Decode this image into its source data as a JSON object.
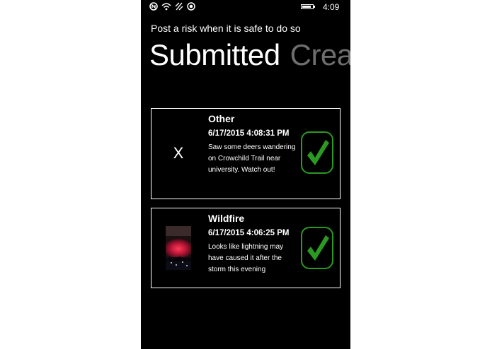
{
  "status_bar": {
    "time": "4:09",
    "battery_level": 0.85,
    "icons": [
      "nfc-icon",
      "wifi-icon",
      "data-signal-icon",
      "location-icon",
      "battery-icon"
    ]
  },
  "header": {
    "subtitle": "Post a risk when it is safe to do so",
    "tabs": [
      {
        "label": "Submitted",
        "active": true
      },
      {
        "label": "Crea",
        "active": false
      }
    ]
  },
  "risks": [
    {
      "thumbnail_text": "X",
      "title": "Other",
      "date": "6/17/2015 4:08:31 PM",
      "description": "Saw some deers wandering on Crowchild Trail near university. Watch out!",
      "status_icon": "checkmark-icon"
    },
    {
      "thumbnail_text": "",
      "title": "Wildfire",
      "date": "6/17/2015 4:06:25 PM",
      "description": "Looks like lightning may have caused it after the storm this evening",
      "status_icon": "checkmark-icon"
    }
  ],
  "colors": {
    "background": "#000000",
    "foreground": "#ffffff",
    "accent_green": "#2a9a22",
    "inactive_tab": "#6e6e6e"
  }
}
